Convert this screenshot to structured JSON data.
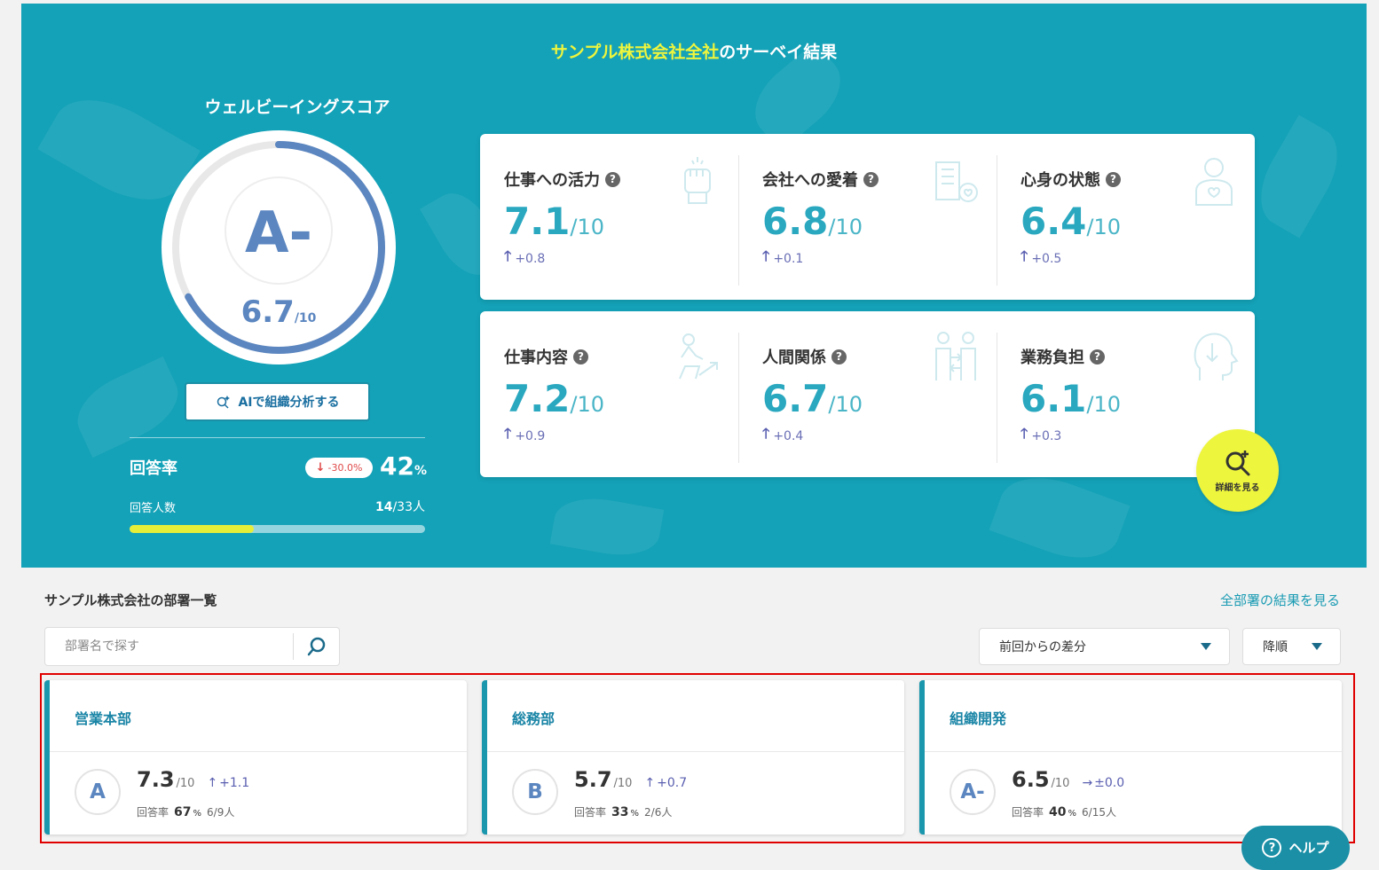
{
  "hero": {
    "company": "サンプル株式会社全社",
    "title_suffix": "のサーベイ結果",
    "wellbeing_label": "ウェルビーイングスコア",
    "grade": "A-",
    "score": "6.7",
    "score_max": "/10",
    "score_fraction": 0.67,
    "ai_button": "AIで組織分析する",
    "response_rate_label": "回答率",
    "response_rate_delta": "-30.0%",
    "response_rate_value": "42",
    "response_rate_unit": "%",
    "respondents_label": "回答人数",
    "respondents_count": "14",
    "respondents_total": "/33人",
    "respondents_fraction": 0.42,
    "detail_button": "詳細を見る"
  },
  "metrics": [
    {
      "name": "仕事への活力",
      "value": "7.1",
      "max": "/10",
      "delta": "+0.8",
      "icon": "fist-icon"
    },
    {
      "name": "会社への愛着",
      "value": "6.8",
      "max": "/10",
      "delta": "+0.1",
      "icon": "building-heart-icon"
    },
    {
      "name": "心身の状態",
      "value": "6.4",
      "max": "/10",
      "delta": "+0.5",
      "icon": "person-heart-icon"
    },
    {
      "name": "仕事内容",
      "value": "7.2",
      "max": "/10",
      "delta": "+0.9",
      "icon": "person-growth-icon"
    },
    {
      "name": "人間関係",
      "value": "6.7",
      "max": "/10",
      "delta": "+0.4",
      "icon": "people-exchange-icon"
    },
    {
      "name": "業務負担",
      "value": "6.1",
      "max": "/10",
      "delta": "+0.3",
      "icon": "head-down-arrow-icon"
    }
  ],
  "departments": {
    "title": "サンプル株式会社の部署一覧",
    "all_link": "全部署の結果を見る",
    "search_placeholder": "部署名で探す",
    "sort_field": "前回からの差分",
    "sort_order": "降順",
    "rate_label": "回答率",
    "items": [
      {
        "name": "営業本部",
        "grade": "A",
        "score": "7.3",
        "max": "/10",
        "delta_arrow": "↑",
        "delta": "+1.1",
        "rate": "67",
        "unit": "%",
        "count": "6/9人"
      },
      {
        "name": "総務部",
        "grade": "B",
        "score": "5.7",
        "max": "/10",
        "delta_arrow": "↑",
        "delta": "+0.7",
        "rate": "33",
        "unit": "%",
        "count": "2/6人"
      },
      {
        "name": "組織開発",
        "grade": "A-",
        "score": "6.5",
        "max": "/10",
        "delta_arrow": "→",
        "delta": "±0.0",
        "rate": "40",
        "unit": "%",
        "count": "6/15人"
      }
    ]
  },
  "help": {
    "label": "ヘルプ"
  },
  "colors": {
    "teal": "#14a2b8",
    "accent_yellow": "#eef53d",
    "score_blue": "#5b86c0",
    "delta_purple": "#5a5fb0",
    "negative_red": "#e04848"
  }
}
